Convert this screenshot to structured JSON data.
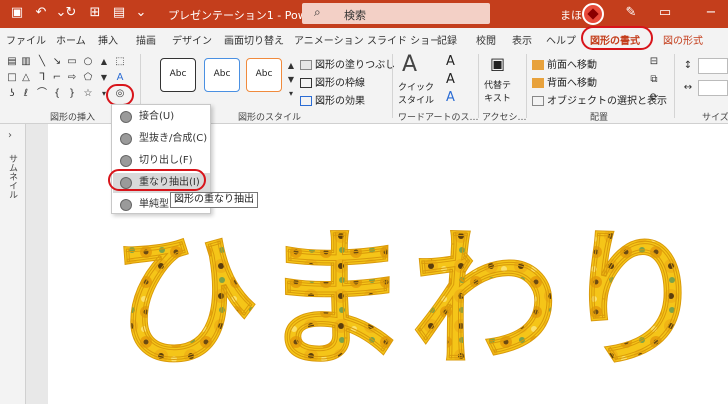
{
  "titlebar": {
    "title": "プレゼンテーション1 - Power…",
    "search_placeholder": "検索",
    "user_name": "まほ",
    "accent": "#c43e1c"
  },
  "tabs": [
    "ファイル",
    "ホーム",
    "挿入",
    "描画",
    "デザイン",
    "画面切り替え",
    "アニメーション",
    "スライド ショー",
    "記録",
    "校閲",
    "表示",
    "ヘルプ",
    "図形の書式",
    "図の形式"
  ],
  "ribbon": {
    "groups": {
      "insert_shapes": "図形の挿入",
      "shape_styles": "図形のスタイル",
      "wordart": "ワードアートのス…",
      "accessibility": "アクセシ…",
      "arrange": "配置",
      "size": "サイズ"
    },
    "style_sample": "Abc",
    "fill": "図形の塗りつぶし",
    "outline": "図形の枠線",
    "effects": "図形の効果",
    "quick_style": "クイック\nスタイル",
    "alt_text": "代替テ\nキスト",
    "bring_forward": "前面へ移動",
    "send_backward": "背面へ移動",
    "selection_pane": "オブジェクトの選択と表示"
  },
  "merge_menu": {
    "items": [
      "接合(U)",
      "型抜き/合成(C)",
      "切り出し(F)",
      "重なり抽出(I)",
      "単純型"
    ],
    "highlighted_index": 3,
    "tooltip": "図形の重なり抽出"
  },
  "thumbnail_pane": {
    "label": "サムネイル"
  },
  "slide": {
    "text": "ひまわり",
    "fill_color": "#f5c518"
  }
}
